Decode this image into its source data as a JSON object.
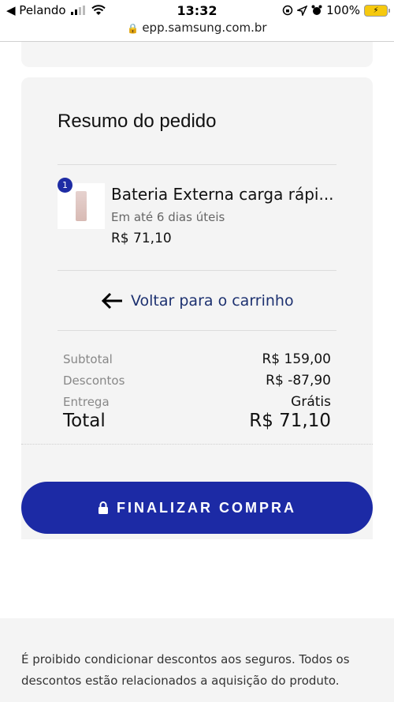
{
  "status": {
    "back_app": "◀ Pelando",
    "time": "13:32",
    "battery": "100%"
  },
  "browser": {
    "url": "epp.samsung.com.br"
  },
  "summary": {
    "title": "Resumo do pedido",
    "item": {
      "quantity": "1",
      "name": "Bateria Externa carga rápi...",
      "delivery": "Em até 6 dias úteis",
      "price": "R$ 71,10"
    },
    "back_link": "Voltar para o carrinho",
    "rows": [
      {
        "label": "Subtotal",
        "value": "R$ 159,00"
      },
      {
        "label": "Descontos",
        "value": "R$ -87,90"
      },
      {
        "label": "Entrega",
        "value": "Grátis"
      }
    ],
    "total_label": "Total",
    "total_value": "R$ 71,10"
  },
  "checkout": {
    "button_label": "FINALIZAR COMPRA"
  },
  "footer": {
    "disclaimer": "É proibido condicionar descontos aos seguros. Todos os descontos estão relacionados a aquisição do produto."
  },
  "colors": {
    "brand": "#1c2aa5",
    "link": "#1d3170",
    "card_bg": "#f4f4f4"
  }
}
